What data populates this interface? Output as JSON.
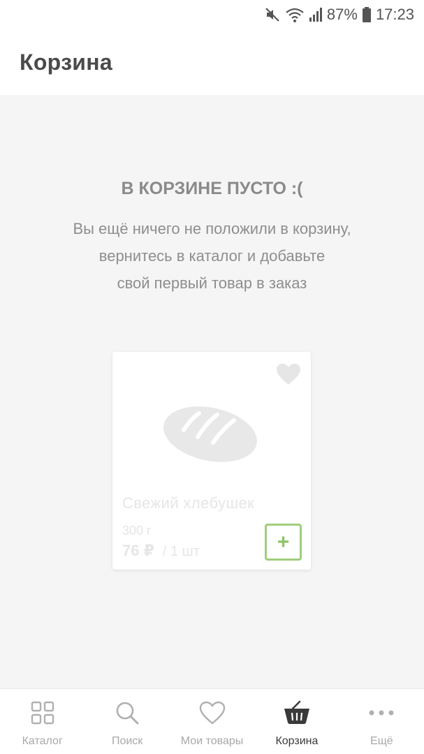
{
  "status_bar": {
    "battery_percent": "87%",
    "time": "17:23",
    "icons": [
      "mute-icon",
      "wifi-icon",
      "signal-icon",
      "battery-icon"
    ]
  },
  "header": {
    "title": "Корзина"
  },
  "empty_state": {
    "title": "В КОРЗИНЕ ПУСТО :(",
    "lines": [
      "Вы ещё ничего не положили в корзину,",
      "вернитесь в каталог и добавьте",
      "свой первый товар в заказ"
    ]
  },
  "product_card": {
    "name": "Свежий хлебушек",
    "weight": "300 г",
    "price": "76 ₽",
    "unit": "/ 1 шт",
    "add_label": "+",
    "icons": {
      "favorite": "heart-icon",
      "image": "bread-icon"
    }
  },
  "bottom_nav": {
    "items": [
      {
        "label": "Каталог",
        "icon": "grid-icon",
        "active": false
      },
      {
        "label": "Поиск",
        "icon": "search-icon",
        "active": false
      },
      {
        "label": "Мои товары",
        "icon": "heart-icon",
        "active": false
      },
      {
        "label": "Корзина",
        "icon": "basket-icon",
        "active": true
      },
      {
        "label": "Ещё",
        "icon": "more-icon",
        "active": false
      }
    ]
  },
  "colors": {
    "accent_green": "#9fce7c",
    "background": "#f5f5f5",
    "text_muted": "#8a8a8a"
  }
}
